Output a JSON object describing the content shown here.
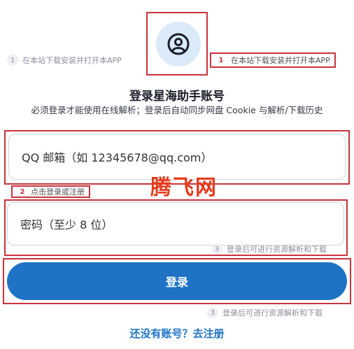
{
  "header": {
    "title": "登录星海助手账号",
    "subtitle": "必须登录才能使用在线解析；登录后自动同步网盘 Cookie 与解析/下载历史"
  },
  "steps": {
    "step1": {
      "num": "1",
      "text": "在本站下载安装并打开本APP"
    },
    "step2": {
      "num": "2",
      "text": "点击登录或注册"
    },
    "step3": {
      "num": "3",
      "text": "登录后可进行资源解析和下载"
    }
  },
  "form": {
    "email_placeholder": "QQ 邮箱（如 12345678@qq.com）",
    "password_placeholder": "密码（至少 8 位）",
    "login_label": "登录"
  },
  "watermark": "腾飞网",
  "footer": {
    "register_label": "还没有账号？去注册"
  },
  "colors": {
    "accent": "#1e73c4",
    "annotation_red": "#c8343c",
    "watermark": "#e63c1e"
  },
  "icons": {
    "avatar": "user-circle-icon"
  }
}
